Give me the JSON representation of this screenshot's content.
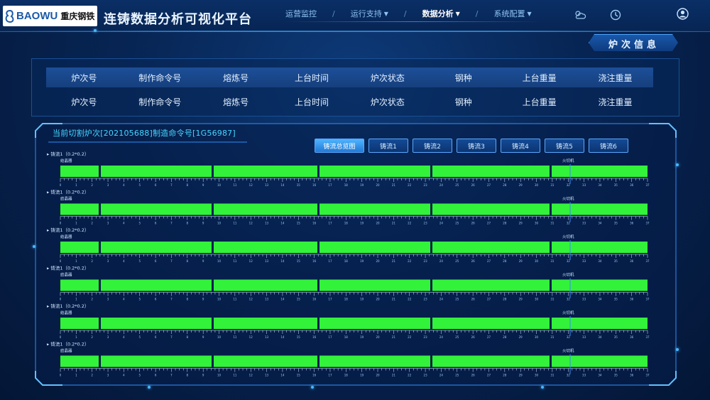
{
  "header": {
    "logo_text": "BAOWU",
    "logo_cn": "重庆钢铁",
    "title": "连铸数据分析可视化平台",
    "nav": [
      {
        "label": "运营监控",
        "dropdown": false,
        "active": false
      },
      {
        "label": "运行支持",
        "dropdown": true,
        "active": false
      },
      {
        "label": "数据分析",
        "dropdown": true,
        "active": true
      },
      {
        "label": "系统配置",
        "dropdown": true,
        "active": false
      }
    ],
    "nav_separator": "/",
    "weather_text": "",
    "time_text": ""
  },
  "section_label": "炉次信息",
  "heat_table": {
    "headers": [
      "炉次号",
      "制作命令号",
      "熔炼号",
      "上台时间",
      "炉次状态",
      "钢种",
      "上台重量",
      "浇注重量"
    ],
    "values": [
      "炉次号",
      "制作命令号",
      "熔炼号",
      "上台时间",
      "炉次状态",
      "钢种",
      "上台重量",
      "浇注重量"
    ]
  },
  "strand_panel": {
    "title": "当前切割炉次[202105688]制造命令号[1G56987]",
    "buttons": [
      {
        "label": "铸流总览图",
        "active": true
      },
      {
        "label": "铸流1",
        "active": false
      },
      {
        "label": "铸流2",
        "active": false
      },
      {
        "label": "铸流3",
        "active": false
      },
      {
        "label": "铸流4",
        "active": false
      },
      {
        "label": "铸流5",
        "active": false
      },
      {
        "label": "铸流6",
        "active": false
      }
    ],
    "strand_label": "▸ 铸流1（0.2*0.2）",
    "segment_start_label": "结晶器",
    "segment_end_label": "火切机",
    "strand_count": 6,
    "segment_count": 6,
    "scale_labels": [
      "0",
      "1",
      "2",
      "3",
      "4",
      "5",
      "6",
      "7",
      "8",
      "9",
      "10",
      "11",
      "12",
      "13",
      "14",
      "15",
      "16",
      "17",
      "18",
      "19",
      "20",
      "21",
      "22",
      "23",
      "24",
      "25",
      "26",
      "27",
      "28",
      "29",
      "30",
      "31",
      "32",
      "33",
      "34",
      "35",
      "36",
      "37"
    ]
  },
  "colors": {
    "bar": "#33f23a",
    "accent": "#39a6ff",
    "title_cyan": "#47d6ff",
    "marker": "#3a8cff"
  }
}
